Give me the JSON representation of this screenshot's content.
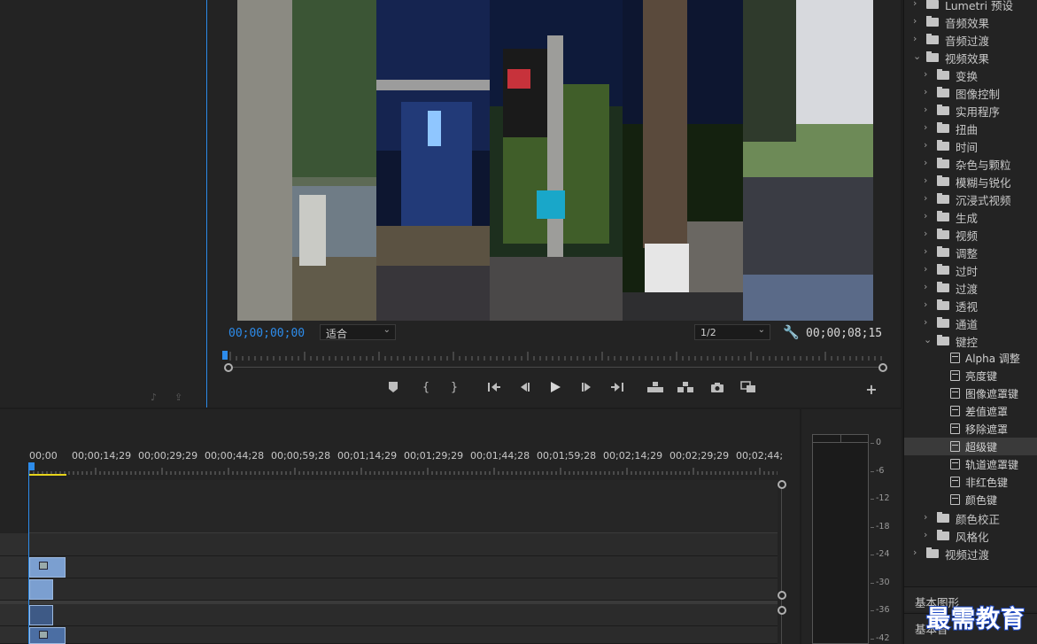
{
  "program_monitor": {
    "timecode_current": "00;00;00;00",
    "zoom_select": "适合",
    "resolution_select": "1/2",
    "timecode_duration": "00;00;08;15"
  },
  "transport": {
    "icons": [
      "marker-icon",
      "in-point-icon",
      "out-point-icon",
      "go-to-in-icon",
      "step-back-icon",
      "play-icon",
      "step-forward-icon",
      "go-to-out-icon",
      "lift-icon",
      "extract-icon",
      "camera-icon",
      "comparison-icon",
      "add-icon"
    ]
  },
  "timeline": {
    "ruler": [
      "00;00",
      "00;00;14;29",
      "00;00;29;29",
      "00;00;44;28",
      "00;00;59;28",
      "00;01;14;29",
      "00;01;29;29",
      "00;01;44;28",
      "00;01;59;28",
      "00;02;14;29",
      "00;02;29;29",
      "00;02;44;"
    ]
  },
  "audio_meter": {
    "labels": [
      "0",
      "-6",
      "-12",
      "-18",
      "-24",
      "-30",
      "-36",
      "-42"
    ]
  },
  "effects_panel": {
    "items": [
      {
        "label": "Lumetri 预设",
        "level": 0,
        "expanded": false
      },
      {
        "label": "音频效果",
        "level": 0,
        "expanded": false
      },
      {
        "label": "音频过渡",
        "level": 0,
        "expanded": false
      },
      {
        "label": "视频效果",
        "level": 0,
        "expanded": true
      },
      {
        "label": "变换",
        "level": 1,
        "expanded": false
      },
      {
        "label": "图像控制",
        "level": 1,
        "expanded": false
      },
      {
        "label": "实用程序",
        "level": 1,
        "expanded": false
      },
      {
        "label": "扭曲",
        "level": 1,
        "expanded": false
      },
      {
        "label": "时间",
        "level": 1,
        "expanded": false
      },
      {
        "label": "杂色与颗粒",
        "level": 1,
        "expanded": false
      },
      {
        "label": "模糊与锐化",
        "level": 1,
        "expanded": false
      },
      {
        "label": "沉浸式视频",
        "level": 1,
        "expanded": false
      },
      {
        "label": "生成",
        "level": 1,
        "expanded": false
      },
      {
        "label": "视频",
        "level": 1,
        "expanded": false
      },
      {
        "label": "调整",
        "level": 1,
        "expanded": false
      },
      {
        "label": "过时",
        "level": 1,
        "expanded": false
      },
      {
        "label": "过渡",
        "level": 1,
        "expanded": false
      },
      {
        "label": "透视",
        "level": 1,
        "expanded": false
      },
      {
        "label": "通道",
        "level": 1,
        "expanded": false
      },
      {
        "label": "键控",
        "level": 1,
        "expanded": true
      },
      {
        "label": "Alpha 调整",
        "level": 2
      },
      {
        "label": "亮度键",
        "level": 2
      },
      {
        "label": "图像遮罩键",
        "level": 2
      },
      {
        "label": "差值遮罩",
        "level": 2
      },
      {
        "label": "移除遮罩",
        "level": 2
      },
      {
        "label": "超级键",
        "level": 2,
        "selected": true
      },
      {
        "label": "轨道遮罩键",
        "level": 2
      },
      {
        "label": "非红色键",
        "level": 2
      },
      {
        "label": "颜色键",
        "level": 2
      },
      {
        "label": "颜色校正",
        "level": 1,
        "expanded": false
      },
      {
        "label": "风格化",
        "level": 1,
        "expanded": false
      },
      {
        "label": "视频过渡",
        "level": 0,
        "expanded": false
      }
    ],
    "bottom_panels": [
      "基本图形",
      "基本音"
    ]
  },
  "watermark": "最需教育",
  "colors": {
    "accent": "#2d8ceb",
    "work_area": "#e6d31a",
    "clip": "#7b9fd0"
  }
}
